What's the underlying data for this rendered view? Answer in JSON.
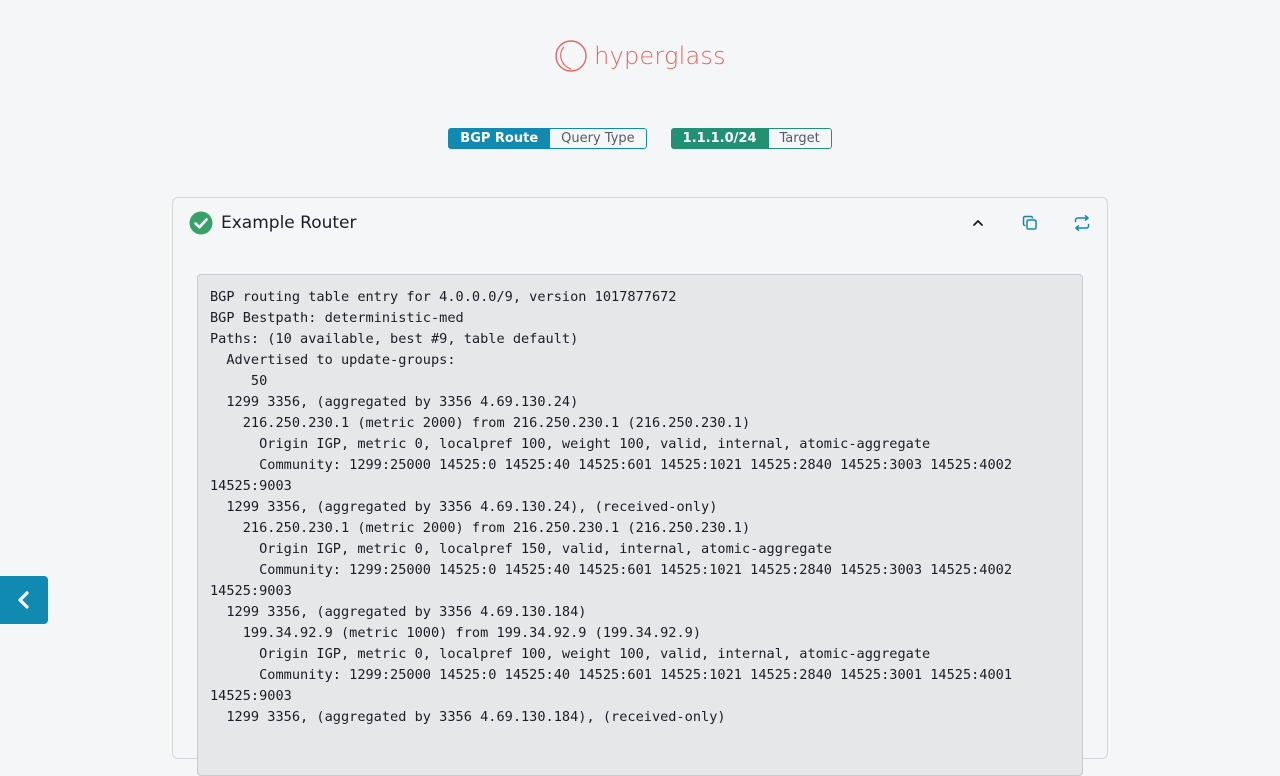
{
  "brand": {
    "name": "hyperglass",
    "color": "#e8655f"
  },
  "query": {
    "type_value": "BGP Route",
    "type_label": "Query Type",
    "target_value": "1.1.1.0/24",
    "target_label": "Target"
  },
  "result": {
    "router_name": "Example Router",
    "status": "success",
    "actions": {
      "collapse_icon": "chevron-up-icon",
      "copy_icon": "copy-icon",
      "requery_icon": "refresh-icon"
    },
    "output": "BGP routing table entry for 4.0.0.0/9, version 1017877672\nBGP Bestpath: deterministic-med\nPaths: (10 available, best #9, table default)\n  Advertised to update-groups:\n     50\n  1299 3356, (aggregated by 3356 4.69.130.24)\n    216.250.230.1 (metric 2000) from 216.250.230.1 (216.250.230.1)\n      Origin IGP, metric 0, localpref 100, weight 100, valid, internal, atomic-aggregate\n      Community: 1299:25000 14525:0 14525:40 14525:601 14525:1021 14525:2840 14525:3003 14525:4002\n14525:9003\n  1299 3356, (aggregated by 3356 4.69.130.24), (received-only)\n    216.250.230.1 (metric 2000) from 216.250.230.1 (216.250.230.1)\n      Origin IGP, metric 0, localpref 150, valid, internal, atomic-aggregate\n      Community: 1299:25000 14525:0 14525:40 14525:601 14525:1021 14525:2840 14525:3003 14525:4002\n14525:9003\n  1299 3356, (aggregated by 3356 4.69.130.184)\n    199.34.92.9 (metric 1000) from 199.34.92.9 (199.34.92.9)\n      Origin IGP, metric 0, localpref 100, weight 100, valid, internal, atomic-aggregate\n      Community: 1299:25000 14525:0 14525:40 14525:601 14525:1021 14525:2840 14525:3001 14525:4001\n14525:9003\n  1299 3356, (aggregated by 3356 4.69.130.184), (received-only)"
  },
  "nav": {
    "back_icon": "chevron-left-icon"
  },
  "colors": {
    "primary": "#118ab2",
    "secondary": "#229173",
    "success": "#38a169",
    "background": "#f5f6f8"
  }
}
